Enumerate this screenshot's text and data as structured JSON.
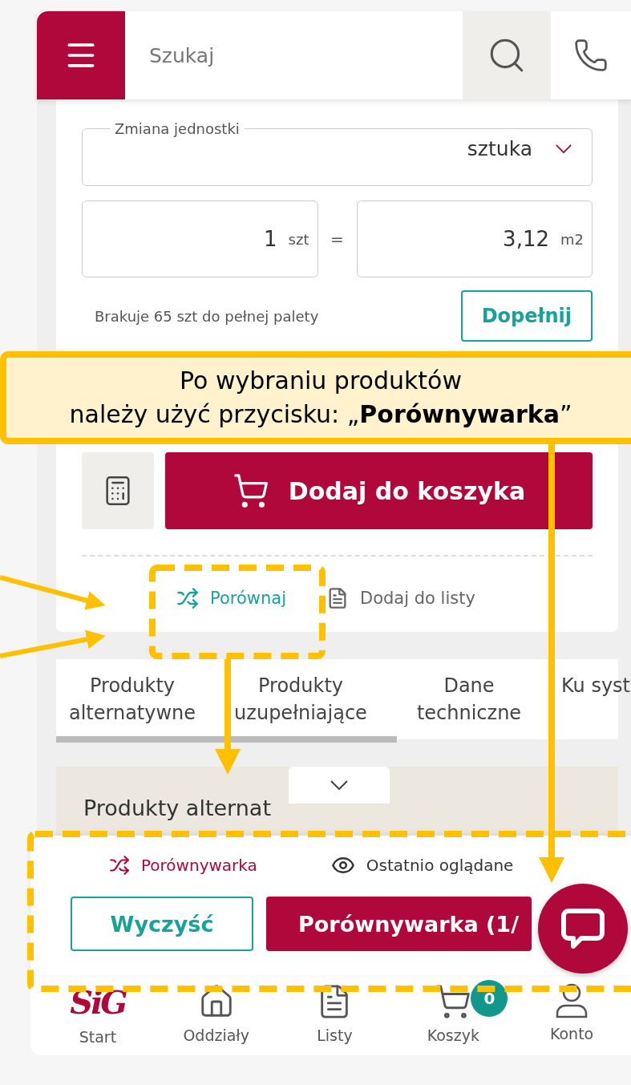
{
  "header": {
    "search_placeholder": "Szukaj"
  },
  "unit_select": {
    "label": "Zmiana jednostki",
    "value": "sztuka"
  },
  "conversion": {
    "quantity": "1",
    "quantity_unit": "szt",
    "equals": "=",
    "area": "3,12",
    "area_unit": "m2"
  },
  "pallet": {
    "message": "Brakuje 65 szt do pełnej palety",
    "button": "Dopełnij"
  },
  "add_to_cart": {
    "button": "Dodaj do koszyka"
  },
  "actions": [
    {
      "label": "Porównaj",
      "kind": "compare"
    },
    {
      "label": "Dodaj do listy",
      "kind": "list"
    }
  ],
  "tabs": [
    {
      "label": "Produkty alternatywne"
    },
    {
      "label": "Produkty uzupełniające"
    },
    {
      "label": "Dane techniczne"
    },
    {
      "label": "Ku syst"
    }
  ],
  "accordion": {
    "title": "Produkty alternat"
  },
  "compare_bar": {
    "links": [
      {
        "label": "Porównywarka",
        "kind": "compare",
        "selected": true
      },
      {
        "label": "Ostatnio oglądane",
        "kind": "recent",
        "selected": false
      }
    ],
    "clear_button": "Wyczyść",
    "compare_button": "Porównywarka (1/"
  },
  "bottom_nav": [
    {
      "label": "Start",
      "kind": "logo",
      "logo": "SiG"
    },
    {
      "label": "Oddziały",
      "kind": "home"
    },
    {
      "label": "Listy",
      "kind": "list"
    },
    {
      "label": "Koszyk",
      "kind": "cart",
      "badge": "0"
    },
    {
      "label": "Konto",
      "kind": "account"
    }
  ],
  "annotation": {
    "line1": "Po wybraniu produktów",
    "line2": "należy użyć przycisku: „**Porównywarka**”"
  }
}
